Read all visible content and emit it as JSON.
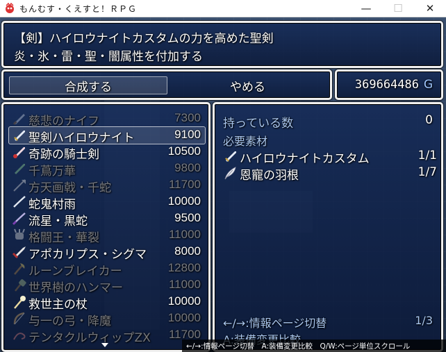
{
  "window": {
    "title": "もんむす・くえすと！ＲＰＧ",
    "minimize_glyph": "—",
    "maximize_glyph": "☐",
    "close_glyph": "✕"
  },
  "help": {
    "line1": "【剣】ハイロウナイトカスタムの力を高めた聖剣",
    "line2": "炎・氷・雷・聖・闇属性を付加する"
  },
  "commands": {
    "synthesize": "合成する",
    "cancel": "やめる"
  },
  "gold": {
    "amount": "369664486",
    "unit": "G"
  },
  "items": [
    {
      "name": "慈悲のナイフ",
      "price": "7300",
      "icon": "knife-icon",
      "enabled": false
    },
    {
      "name": "聖剣ハイロウナイト",
      "price": "9100",
      "icon": "sword-icon",
      "enabled": true,
      "selected": true
    },
    {
      "name": "奇跡の騎士剣",
      "price": "10500",
      "icon": "sword-icon",
      "enabled": true
    },
    {
      "name": "千蔦万華",
      "price": "9800",
      "icon": "sword-icon",
      "enabled": false
    },
    {
      "name": "方天画戟・千蛇",
      "price": "11700",
      "icon": "spear-icon",
      "enabled": false
    },
    {
      "name": "蛇鬼村雨",
      "price": "10000",
      "icon": "katana-icon",
      "enabled": true
    },
    {
      "name": "流星・黒蛇",
      "price": "9500",
      "icon": "katana-icon",
      "enabled": true
    },
    {
      "name": "格闘王・華裂",
      "price": "11000",
      "icon": "claw-icon",
      "enabled": false
    },
    {
      "name": "アポカリプス・シグマ",
      "price": "8000",
      "icon": "greatsword-icon",
      "enabled": true
    },
    {
      "name": "ルーンブレイカー",
      "price": "12800",
      "icon": "axe-icon",
      "enabled": false
    },
    {
      "name": "世界樹のハンマー",
      "price": "11000",
      "icon": "hammer-icon",
      "enabled": false
    },
    {
      "name": "救世主の杖",
      "price": "10000",
      "icon": "staff-icon",
      "enabled": true
    },
    {
      "name": "与一の弓・降魔",
      "price": "10000",
      "icon": "bow-icon",
      "enabled": false
    },
    {
      "name": "テンタクルウィップZX",
      "price": "11700",
      "icon": "whip-icon",
      "enabled": false
    }
  ],
  "info": {
    "have_label": "持っている数",
    "have_value": "0",
    "required_label": "必要素材",
    "materials": [
      {
        "name": "ハイロウナイトカスタム",
        "count": "1/1",
        "icon": "sword-icon"
      },
      {
        "name": "恩寵の羽根",
        "count": "1/7",
        "icon": "feather-icon"
      }
    ],
    "page_switch": "←/→:情報ページ切替",
    "page_number": "1/3",
    "compare": "A:装備変更比較"
  },
  "key_help": "←/→:情報ページ切替　A:装備変更比較　Q/W:ページ単位スクロール",
  "colors": {
    "window_border": "#f0f0f0",
    "window_bg": "#122856",
    "system_text": "#a9c6ee",
    "gold_unit": "#9ec5ff"
  }
}
